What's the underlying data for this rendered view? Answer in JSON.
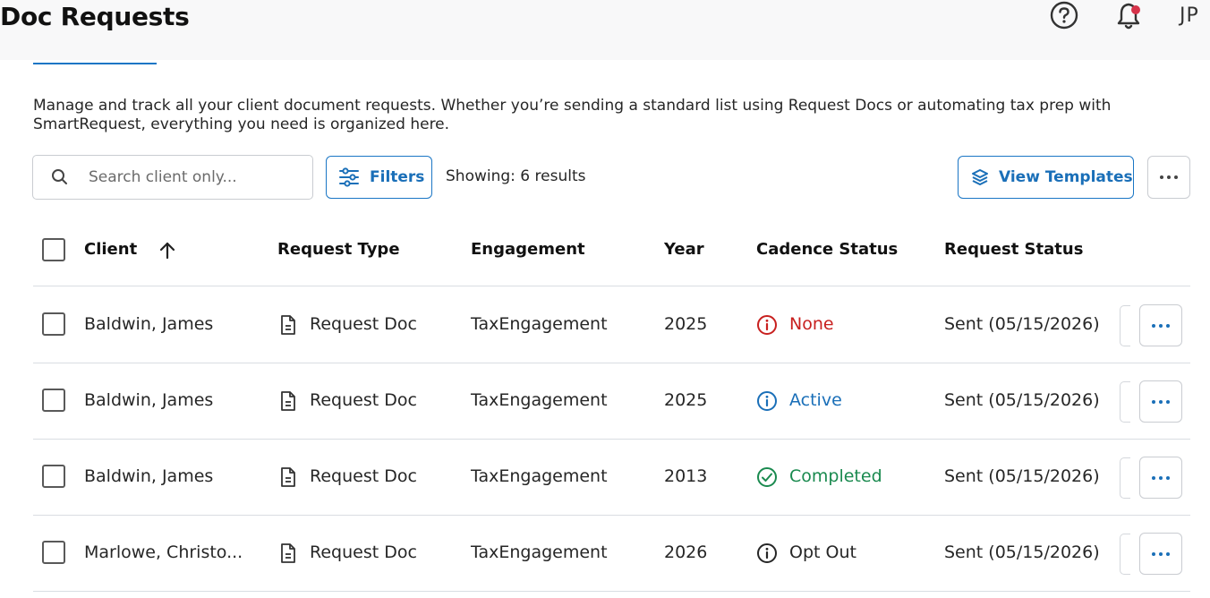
{
  "header": {
    "title": "Doc Requests",
    "avatar_initials": "JP"
  },
  "description": "Manage and track all your client document requests. Whether you’re sending a standard list using Request Docs or automating tax prep with SmartRequest, everything you need is organized here.",
  "toolbar": {
    "search_placeholder": "Search client only...",
    "filters_label": "Filters",
    "results_text": "Showing: 6 results",
    "view_templates_label": "View Templates"
  },
  "table": {
    "columns": {
      "client": "Client",
      "request_type": "Request Type",
      "engagement": "Engagement",
      "year": "Year",
      "cadence_status": "Cadence Status",
      "request_status": "Request Status"
    },
    "rows": [
      {
        "client": "Baldwin, James",
        "request_type": "Request Doc",
        "engagement": "TaxEngagement",
        "year": "2025",
        "cadence_status": "None",
        "cadence_color": "#c8201f",
        "request_status": "Sent (05/15/2026)"
      },
      {
        "client": "Baldwin, James",
        "request_type": "Request Doc",
        "engagement": "TaxEngagement",
        "year": "2025",
        "cadence_status": "Active",
        "cadence_color": "#1a6fb8",
        "request_status": "Sent (05/15/2026)"
      },
      {
        "client": "Baldwin, James",
        "request_type": "Request Doc",
        "engagement": "TaxEngagement",
        "year": "2013",
        "cadence_status": "Completed",
        "cadence_color": "#1a8a4f",
        "request_status": "Sent (05/15/2026)"
      },
      {
        "client": "Marlowe, Christo...",
        "request_type": "Request Doc",
        "engagement": "TaxEngagement",
        "year": "2026",
        "cadence_status": "Opt Out",
        "cadence_color": "#262626",
        "request_status": "Sent (05/15/2026)"
      }
    ]
  },
  "colors": {
    "accent": "#1a76c5",
    "notification_dot": "#d6334a"
  }
}
